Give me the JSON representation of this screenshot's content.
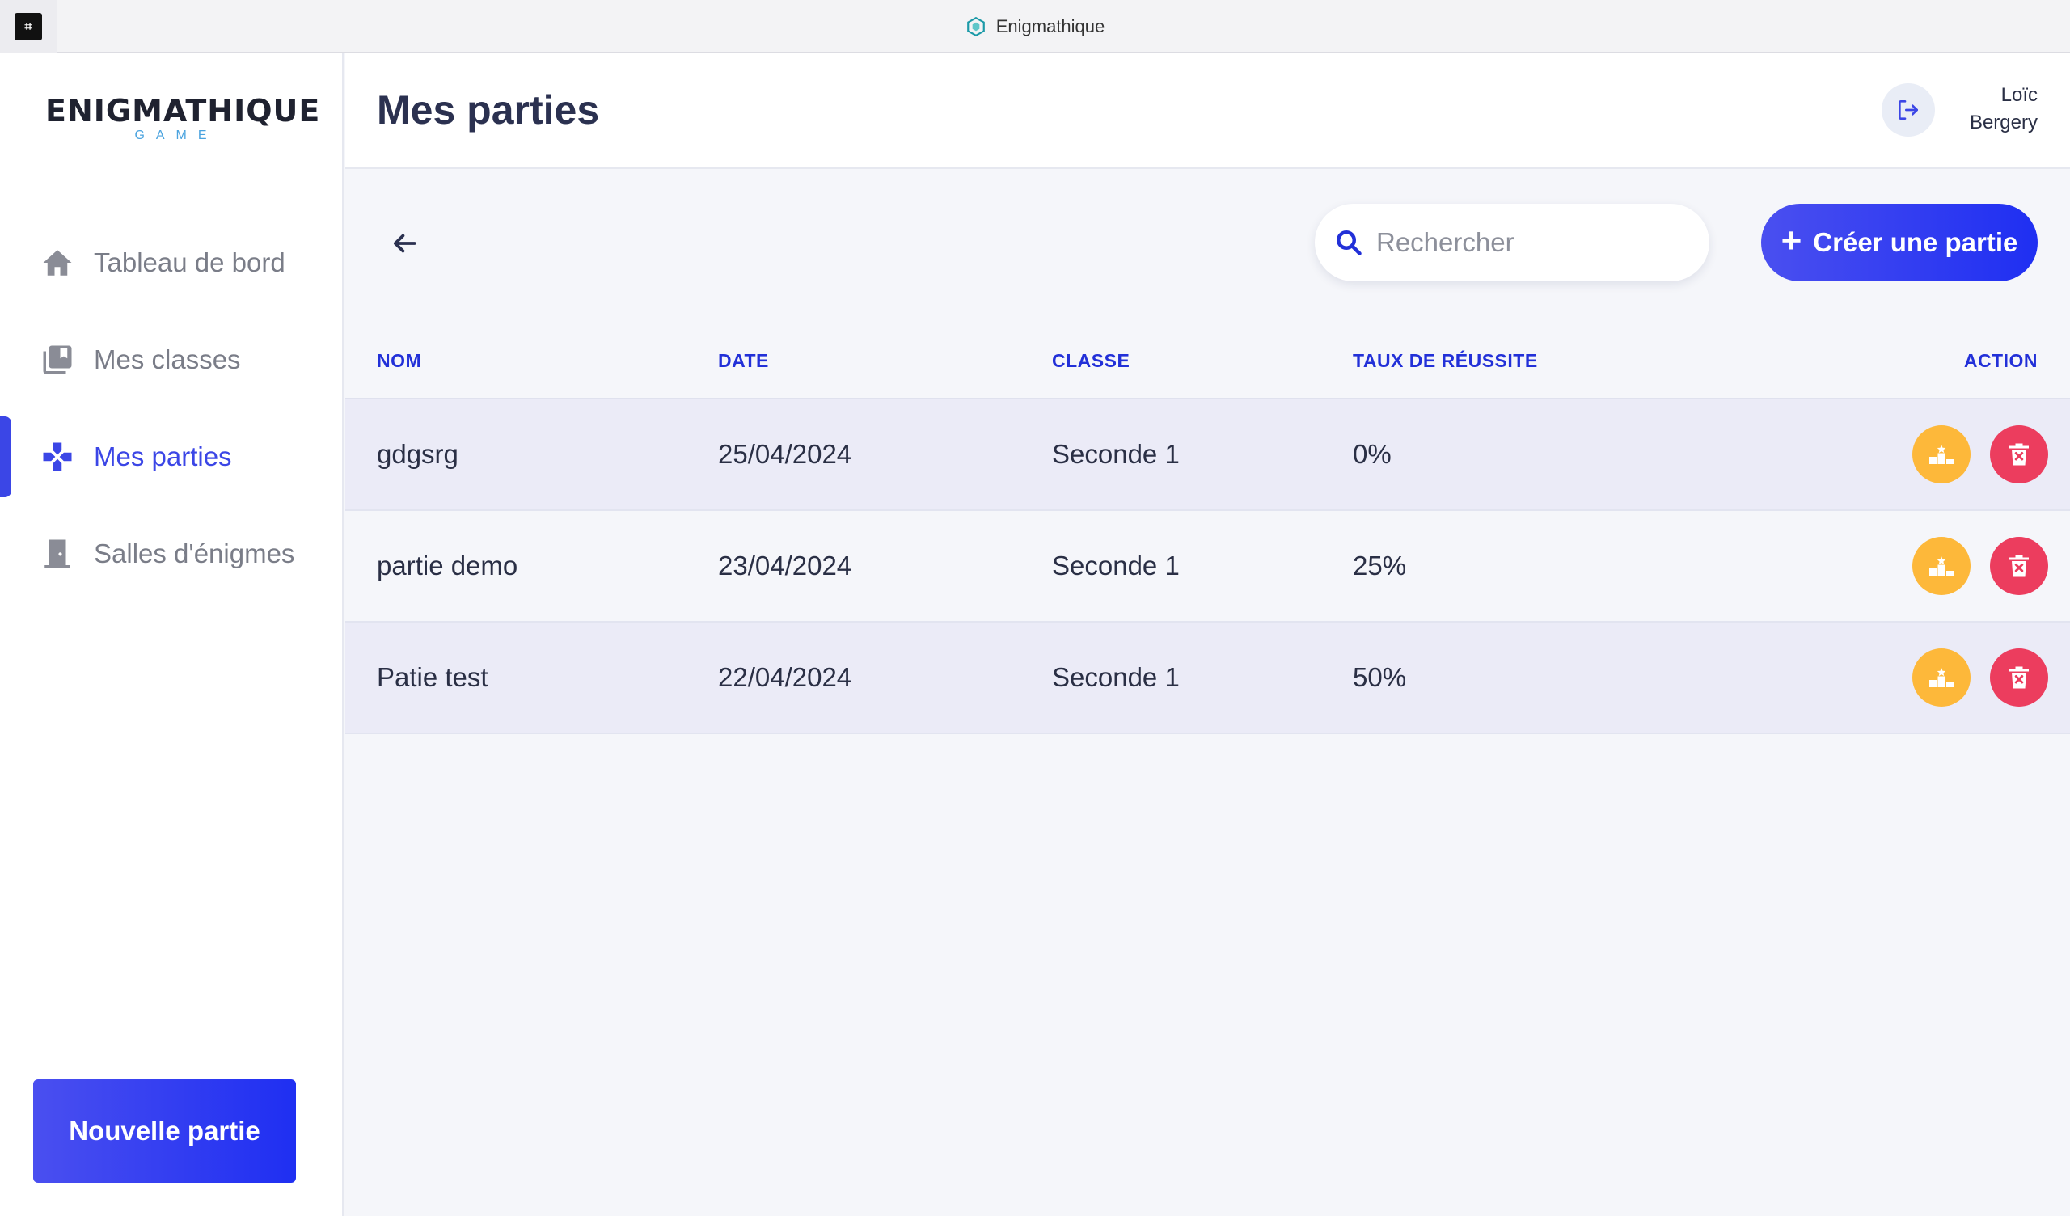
{
  "window": {
    "title": "Enigmathique"
  },
  "sidebar": {
    "logo_main": "ENIGMATHIQUE",
    "logo_sub": "GAME",
    "items": [
      {
        "label": "Tableau de bord",
        "icon": "home-icon",
        "active": false
      },
      {
        "label": "Mes classes",
        "icon": "library-icon",
        "active": false
      },
      {
        "label": "Mes parties",
        "icon": "gamepad-icon",
        "active": true
      },
      {
        "label": "Salles d'énigmes",
        "icon": "door-icon",
        "active": false
      }
    ],
    "new_game_label": "Nouvelle partie"
  },
  "header": {
    "title": "Mes parties",
    "user_first": "Loïc",
    "user_last": "Bergery"
  },
  "toolbar": {
    "search_placeholder": "Rechercher",
    "create_label": "Créer une partie"
  },
  "table": {
    "headers": {
      "nom": "NOM",
      "date": "DATE",
      "classe": "CLASSE",
      "taux": "TAUX DE RÉUSSITE",
      "action": "ACTION"
    },
    "rows": [
      {
        "nom": "gdgsrg",
        "date": "25/04/2024",
        "classe": "Seconde 1",
        "taux": "0%"
      },
      {
        "nom": "partie demo",
        "date": "23/04/2024",
        "classe": "Seconde 1",
        "taux": "25%"
      },
      {
        "nom": "Patie test",
        "date": "22/04/2024",
        "classe": "Seconde 1",
        "taux": "50%"
      }
    ]
  },
  "colors": {
    "accent": "#3b46e6",
    "podium": "#fdb83a",
    "danger": "#ec3d5e",
    "header_text": "#2230d8"
  }
}
